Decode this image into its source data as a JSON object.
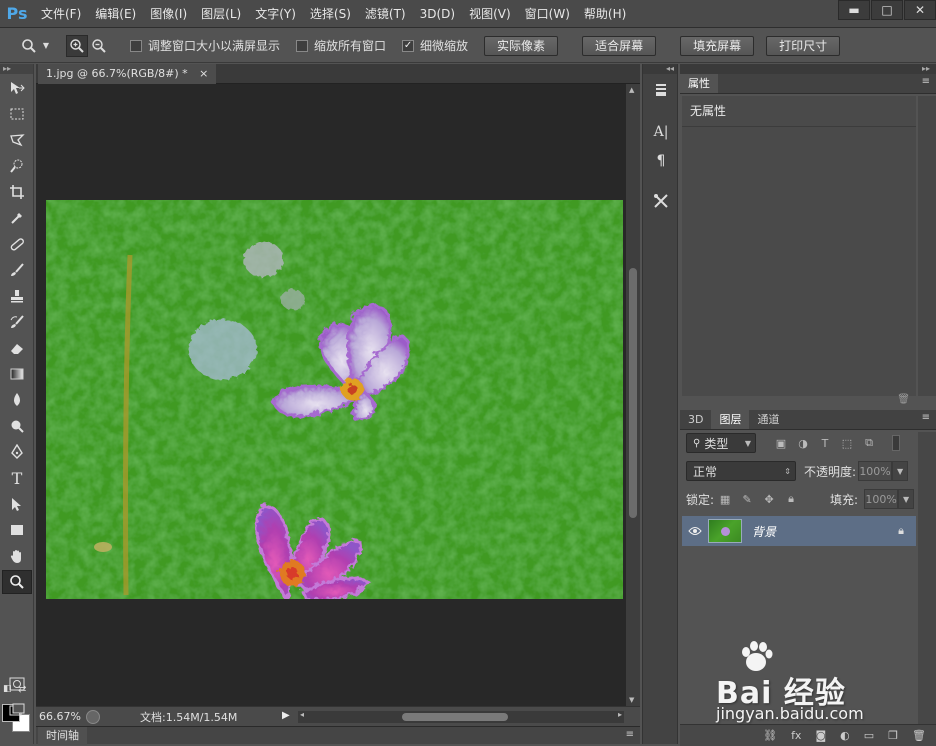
{
  "app": {
    "logo": "Ps"
  },
  "menu": [
    "文件(F)",
    "编辑(E)",
    "图像(I)",
    "图层(L)",
    "文字(Y)",
    "选择(S)",
    "滤镜(T)",
    "3D(D)",
    "视图(V)",
    "窗口(W)",
    "帮助(H)"
  ],
  "options": {
    "resize_windows": "调整窗口大小以满屏显示",
    "zoom_all": "缩放所有窗口",
    "scrubby_zoom": "细微缩放",
    "scrubby_checked": true,
    "buttons": [
      "实际像素",
      "适合屏幕",
      "填充屏幕",
      "打印尺寸"
    ]
  },
  "document": {
    "tab_title": "1.jpg @ 66.7%(RGB/8#) *",
    "tab_close": "×"
  },
  "status": {
    "zoom": "66.67%",
    "doc_info": "文档:1.54M/1.54M"
  },
  "timeline": {
    "label": "时间轴"
  },
  "properties": {
    "tab": "属性",
    "none_label": "无属性"
  },
  "layers_panel": {
    "tabs": [
      "3D",
      "图层",
      "通道"
    ],
    "filter_kind": "类型",
    "blend_mode": "正常",
    "opacity_label": "不透明度:",
    "opacity_value": "100%",
    "lock_label": "锁定:",
    "fill_label": "填充:",
    "fill_value": "100%",
    "layer_name": "背景"
  },
  "watermark": {
    "brand": "Bai 经验",
    "url": "jingyan.baidu.com"
  },
  "colors": {
    "accent": "#4fa8e8",
    "selected_layer": "#5d6e86",
    "canvas_green": "#3f9a22",
    "flower_purple": "#9b5cc8"
  }
}
